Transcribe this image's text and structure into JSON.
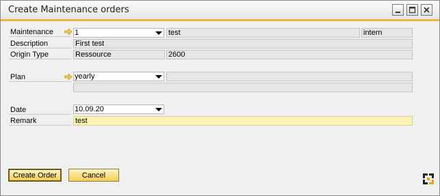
{
  "window": {
    "title": "Create Maintenance orders"
  },
  "form": {
    "maintenance": {
      "label": "Maintenance",
      "value": "1",
      "name": "test",
      "type": "intern"
    },
    "description": {
      "label": "Description",
      "value": "First test"
    },
    "origin_type": {
      "label": "Origin Type",
      "value": "Ressource",
      "code": "2600"
    },
    "plan": {
      "label": "Plan",
      "value": "yearly",
      "extra1": "",
      "extra2": ""
    },
    "date": {
      "label": "Date",
      "value": "10.09.20"
    },
    "remark": {
      "label": "Remark",
      "value": "test"
    }
  },
  "buttons": {
    "create_order": "Create Order",
    "cancel": "Cancel"
  },
  "colors": {
    "accent": "#f0b832",
    "button_top": "#fff3c4",
    "button_bottom": "#f4cd55",
    "remark_bg": "#fcf4b6"
  }
}
